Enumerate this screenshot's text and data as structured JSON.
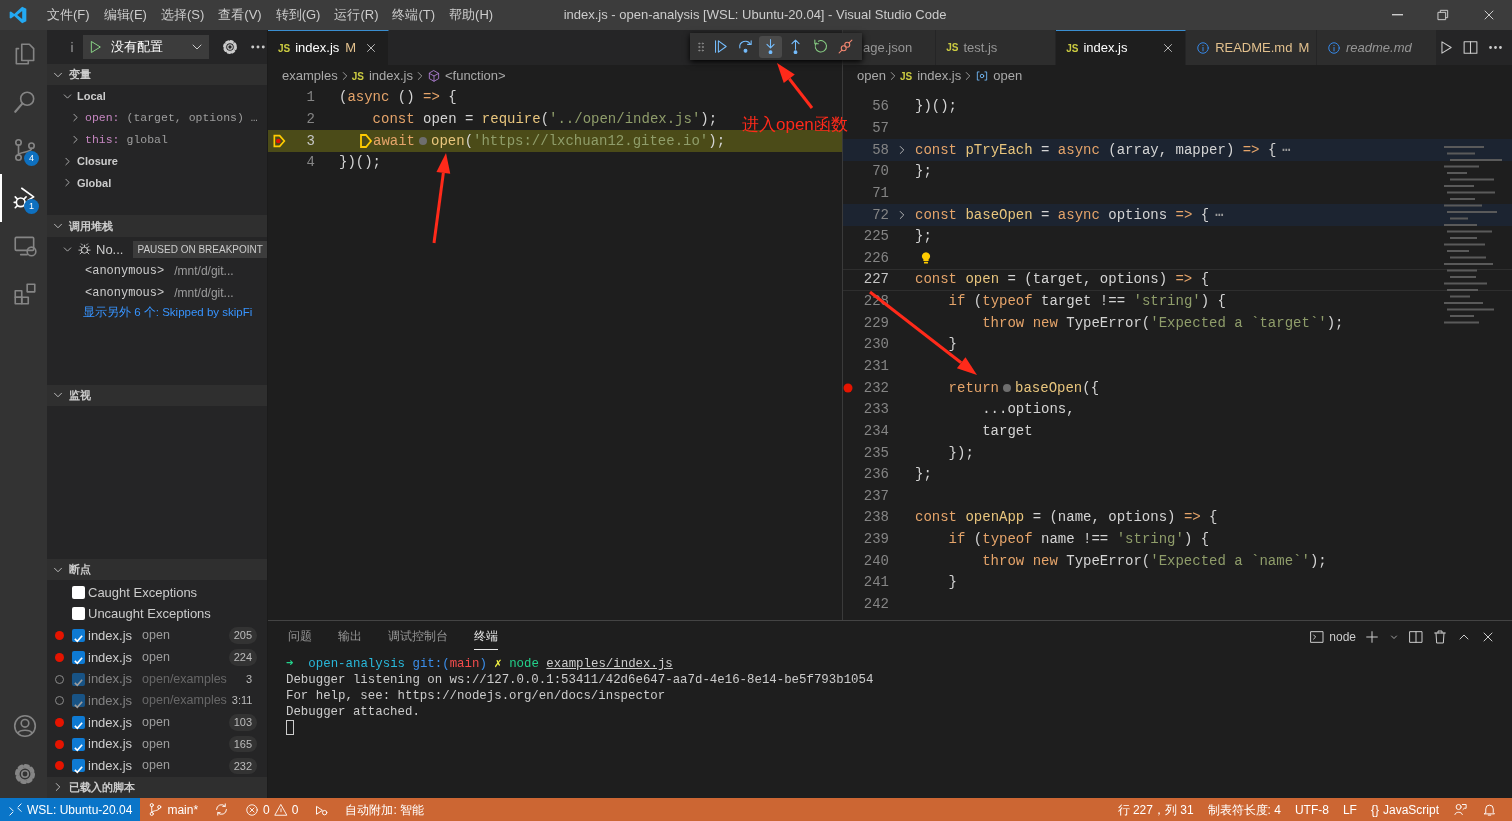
{
  "title_bar": {
    "menus": [
      "文件(F)",
      "编辑(E)",
      "选择(S)",
      "查看(V)",
      "转到(G)",
      "运行(R)",
      "终端(T)",
      "帮助(H)"
    ],
    "title": "index.js - open-analysis [WSL: Ubuntu-20.04] - Visual Studio Code"
  },
  "activity_bar": {
    "items": [
      {
        "kind": "files",
        "selected": false
      },
      {
        "kind": "search",
        "selected": false
      },
      {
        "kind": "scm",
        "selected": false,
        "badge": "4"
      },
      {
        "kind": "debug",
        "selected": true,
        "badge": "1"
      },
      {
        "kind": "remote",
        "selected": false
      },
      {
        "kind": "extensions",
        "selected": false
      }
    ],
    "bottom": [
      {
        "kind": "account"
      },
      {
        "kind": "settings"
      }
    ]
  },
  "sidebar": {
    "config": "没有配置",
    "variables": {
      "title": "变量",
      "expanded": true,
      "scopes": [
        {
          "label": "Local",
          "expanded": true,
          "children": [
            {
              "name": "open:",
              "value": "(target, options) …",
              "expanded": false
            },
            {
              "name": "this:",
              "value": "global",
              "expanded": false
            }
          ]
        },
        {
          "label": "Closure",
          "expanded": false
        },
        {
          "label": "Global",
          "expanded": false
        }
      ]
    },
    "call_stack": {
      "title": "调用堆栈",
      "expanded": true,
      "thread": "No...",
      "status": "PAUSED ON BREAKPOINT",
      "frames": [
        {
          "name": "<anonymous>",
          "path": "/mnt/d/git..."
        },
        {
          "name": "<anonymous>",
          "path": "/mnt/d/git..."
        }
      ],
      "more": "显示另外 6 个: Skipped by skipFi"
    },
    "watch": {
      "title": "监视",
      "expanded": true
    },
    "breakpoints": {
      "title": "断点",
      "expanded": true,
      "exceptions": [
        {
          "label": "Caught Exceptions",
          "checked": false
        },
        {
          "label": "Uncaught Exceptions",
          "checked": false
        }
      ],
      "items": [
        {
          "file": "index.js",
          "path": "open",
          "line": "205",
          "checked": true,
          "verified": true
        },
        {
          "file": "index.js",
          "path": "open",
          "line": "224",
          "checked": true,
          "verified": true
        },
        {
          "file": "index.js",
          "path": "open/examples",
          "line": "3",
          "checked": true,
          "verified": false
        },
        {
          "file": "index.js",
          "path": "open/examples",
          "line": "3:11",
          "checked": true,
          "verified": false
        },
        {
          "file": "index.js",
          "path": "open",
          "line": "103",
          "checked": true,
          "verified": true
        },
        {
          "file": "index.js",
          "path": "open",
          "line": "165",
          "checked": true,
          "verified": true
        },
        {
          "file": "index.js",
          "path": "open",
          "line": "232",
          "checked": true,
          "verified": true
        }
      ]
    },
    "loaded_scripts": {
      "title": "已载入的脚本",
      "expanded": false
    }
  },
  "debug_toolbar": {
    "buttons": [
      {
        "kind": "continue",
        "selected": false
      },
      {
        "kind": "step-over",
        "selected": false
      },
      {
        "kind": "step-into",
        "selected": true
      },
      {
        "kind": "step-out",
        "selected": false
      },
      {
        "kind": "restart",
        "selected": false
      },
      {
        "kind": "disconnect",
        "selected": false
      }
    ]
  },
  "left_editor": {
    "tabs": [
      {
        "label": "index.js",
        "kind": "js",
        "icon_text": "JS",
        "status": "M",
        "selected": true,
        "preview": false
      }
    ],
    "breadcrumbs": [
      {
        "label": "examples"
      },
      {
        "label": "index.js",
        "kind": "js",
        "icon_text": "JS"
      },
      {
        "label": "<function>",
        "kind": "function"
      }
    ],
    "lines": [
      {
        "number": "1",
        "breakpoint": false,
        "paused": false,
        "folded": false,
        "code": [
          {
            "kind": "plain",
            "text": "("
          },
          {
            "kind": "keyword",
            "text": "async"
          },
          {
            "kind": "plain",
            "text": " () "
          },
          {
            "kind": "keyword",
            "text": "=>"
          },
          {
            "kind": "plain",
            "text": " {"
          }
        ]
      },
      {
        "number": "2",
        "breakpoint": false,
        "paused": false,
        "folded": false,
        "code": [
          {
            "kind": "keyword",
            "text": "    const "
          },
          {
            "kind": "plain",
            "text": "open = "
          },
          {
            "kind": "function",
            "text": "require"
          },
          {
            "kind": "plain",
            "text": "("
          },
          {
            "kind": "string",
            "text": "'../open/index.js'"
          },
          {
            "kind": "plain",
            "text": ");"
          }
        ]
      },
      {
        "number": "3",
        "breakpoint": true,
        "paused": true,
        "folded": false,
        "code": [
          {
            "kind": "stop"
          },
          {
            "kind": "keyword",
            "text": "await"
          },
          {
            "kind": "dot"
          },
          {
            "kind": "function",
            "text": "open"
          },
          {
            "kind": "plain",
            "text": "("
          },
          {
            "kind": "string",
            "text": "'https://lxchuan12.gitee.io'"
          },
          {
            "kind": "plain",
            "text": ");"
          }
        ]
      },
      {
        "number": "4",
        "breakpoint": false,
        "paused": false,
        "folded": false,
        "code": [
          {
            "kind": "plain",
            "text": "})();"
          }
        ]
      }
    ]
  },
  "right_editor": {
    "tabs": [
      {
        "label": "age.json",
        "kind": "json",
        "selected": false,
        "preview": false
      },
      {
        "label": "test.js",
        "kind": "js",
        "icon_text": "JS",
        "selected": false,
        "preview": false
      },
      {
        "label": "index.js",
        "kind": "js",
        "icon_text": "JS",
        "selected": true,
        "preview": false
      },
      {
        "label": "README.md",
        "kind": "info",
        "status": "M",
        "selected": false,
        "preview": false
      },
      {
        "label": "readme.md",
        "kind": "info",
        "selected": false,
        "preview": true
      }
    ],
    "breadcrumbs": [
      {
        "label": "open"
      },
      {
        "label": "index.js",
        "kind": "js",
        "icon_text": "JS"
      },
      {
        "label": "open",
        "kind": "variable"
      }
    ],
    "lines": [
      {
        "number": "56",
        "breakpoint": false,
        "cursor": false,
        "folded": false,
        "code": [
          {
            "kind": "plain",
            "text": "})();"
          }
        ]
      },
      {
        "number": "57",
        "breakpoint": false,
        "cursor": false,
        "folded": false
      },
      {
        "number": "58",
        "breakpoint": false,
        "cursor": false,
        "folded": true,
        "code": [
          {
            "kind": "keyword",
            "text": "const "
          },
          {
            "kind": "function",
            "text": "pTryEach"
          },
          {
            "kind": "plain",
            "text": " = "
          },
          {
            "kind": "keyword",
            "text": "async "
          },
          {
            "kind": "plain",
            "text": "(array, mapper) "
          },
          {
            "kind": "keyword",
            "text": "=>"
          },
          {
            "kind": "plain",
            "text": " {"
          },
          {
            "kind": "fold",
            "text": "⋯"
          }
        ]
      },
      {
        "number": "70",
        "breakpoint": false,
        "cursor": false,
        "folded": false,
        "code": [
          {
            "kind": "plain",
            "text": "};"
          }
        ]
      },
      {
        "number": "71",
        "breakpoint": false,
        "cursor": false,
        "folded": false
      },
      {
        "number": "72",
        "breakpoint": false,
        "cursor": false,
        "folded": true,
        "code": [
          {
            "kind": "keyword",
            "text": "const "
          },
          {
            "kind": "function",
            "text": "baseOpen"
          },
          {
            "kind": "plain",
            "text": " = "
          },
          {
            "kind": "keyword",
            "text": "async "
          },
          {
            "kind": "plain",
            "text": "options "
          },
          {
            "kind": "keyword",
            "text": "=>"
          },
          {
            "kind": "plain",
            "text": " {"
          },
          {
            "kind": "fold",
            "text": "⋯"
          }
        ]
      },
      {
        "number": "225",
        "breakpoint": false,
        "cursor": false,
        "folded": false,
        "code": [
          {
            "kind": "plain",
            "text": "};"
          }
        ]
      },
      {
        "number": "226",
        "breakpoint": false,
        "cursor": false,
        "folded": false,
        "code": [
          {
            "kind": "bulb"
          }
        ]
      },
      {
        "number": "227",
        "breakpoint": false,
        "cursor": true,
        "folded": false,
        "code": [
          {
            "kind": "keyword",
            "text": "const "
          },
          {
            "kind": "function",
            "text": "open"
          },
          {
            "kind": "plain",
            "text": " = (target, options) "
          },
          {
            "kind": "keyword",
            "text": "=>"
          },
          {
            "kind": "plain",
            "text": " {"
          }
        ]
      },
      {
        "number": "228",
        "breakpoint": false,
        "cursor": false,
        "folded": false,
        "code": [
          {
            "kind": "keyword",
            "text": "    if "
          },
          {
            "kind": "plain",
            "text": "("
          },
          {
            "kind": "keyword",
            "text": "typeof"
          },
          {
            "kind": "plain",
            "text": " target !== "
          },
          {
            "kind": "string",
            "text": "'string'"
          },
          {
            "kind": "plain",
            "text": ") {"
          }
        ]
      },
      {
        "number": "229",
        "breakpoint": false,
        "cursor": false,
        "folded": false,
        "code": [
          {
            "kind": "keyword",
            "text": "        throw new "
          },
          {
            "kind": "plain",
            "text": "TypeError("
          },
          {
            "kind": "string",
            "text": "'Expected a `target`'"
          },
          {
            "kind": "plain",
            "text": ");"
          }
        ]
      },
      {
        "number": "230",
        "breakpoint": false,
        "cursor": false,
        "folded": false,
        "code": [
          {
            "kind": "plain",
            "text": "    }"
          }
        ]
      },
      {
        "number": "231",
        "breakpoint": false,
        "cursor": false,
        "folded": false
      },
      {
        "number": "232",
        "breakpoint": true,
        "cursor": false,
        "folded": false,
        "code": [
          {
            "kind": "keyword",
            "text": "    return"
          },
          {
            "kind": "dot"
          },
          {
            "kind": "function",
            "text": "baseOpen"
          },
          {
            "kind": "plain",
            "text": "({"
          }
        ]
      },
      {
        "number": "233",
        "breakpoint": false,
        "cursor": false,
        "folded": false,
        "code": [
          {
            "kind": "plain",
            "text": "        ...options,"
          }
        ]
      },
      {
        "number": "234",
        "breakpoint": false,
        "cursor": false,
        "folded": false,
        "code": [
          {
            "kind": "plain",
            "text": "        target"
          }
        ]
      },
      {
        "number": "235",
        "breakpoint": false,
        "cursor": false,
        "folded": false,
        "code": [
          {
            "kind": "plain",
            "text": "    });"
          }
        ]
      },
      {
        "number": "236",
        "breakpoint": false,
        "cursor": false,
        "folded": false,
        "code": [
          {
            "kind": "plain",
            "text": "};"
          }
        ]
      },
      {
        "number": "237",
        "breakpoint": false,
        "cursor": false,
        "folded": false
      },
      {
        "number": "238",
        "breakpoint": false,
        "cursor": false,
        "folded": false,
        "code": [
          {
            "kind": "keyword",
            "text": "const "
          },
          {
            "kind": "function",
            "text": "openApp"
          },
          {
            "kind": "plain",
            "text": " = (name, options) "
          },
          {
            "kind": "keyword",
            "text": "=>"
          },
          {
            "kind": "plain",
            "text": " {"
          }
        ]
      },
      {
        "number": "239",
        "breakpoint": false,
        "cursor": false,
        "folded": false,
        "code": [
          {
            "kind": "keyword",
            "text": "    if "
          },
          {
            "kind": "plain",
            "text": "("
          },
          {
            "kind": "keyword",
            "text": "typeof"
          },
          {
            "kind": "plain",
            "text": " name !== "
          },
          {
            "kind": "string",
            "text": "'string'"
          },
          {
            "kind": "plain",
            "text": ") {"
          }
        ]
      },
      {
        "number": "240",
        "breakpoint": false,
        "cursor": false,
        "folded": false,
        "code": [
          {
            "kind": "keyword",
            "text": "        throw new "
          },
          {
            "kind": "plain",
            "text": "TypeError("
          },
          {
            "kind": "string",
            "text": "'Expected a `name`'"
          },
          {
            "kind": "plain",
            "text": ");"
          }
        ]
      },
      {
        "number": "241",
        "breakpoint": false,
        "cursor": false,
        "folded": false,
        "code": [
          {
            "kind": "plain",
            "text": "    }"
          }
        ]
      },
      {
        "number": "242",
        "breakpoint": false,
        "cursor": false,
        "folded": false
      }
    ]
  },
  "annotation": {
    "text": "进入open函数"
  },
  "panel": {
    "tabs": [
      {
        "label": "问题",
        "selected": false
      },
      {
        "label": "输出",
        "selected": false
      },
      {
        "label": "调试控制台",
        "selected": false
      },
      {
        "label": "终端",
        "selected": true
      }
    ],
    "terminal_name": "node",
    "terminal": [
      {
        "segments": [
          {
            "kind": "prompt",
            "text": "➜  "
          },
          {
            "kind": "dir",
            "text": "open-analysis "
          },
          {
            "kind": "git",
            "text": "git:("
          },
          {
            "kind": "branch",
            "text": "main"
          },
          {
            "kind": "git",
            "text": ") "
          },
          {
            "kind": "dirty",
            "text": "✗ "
          },
          {
            "kind": "cmd",
            "text": "node "
          },
          {
            "kind": "arg",
            "text": "examples/index.js"
          }
        ]
      },
      {
        "segments": [
          {
            "kind": "out",
            "text": "Debugger listening on ws://127.0.0.1:53411/42d6e647-aa7d-4e16-8e14-be5f793b1054"
          }
        ]
      },
      {
        "segments": [
          {
            "kind": "out",
            "text": "For help, see: https://nodejs.org/en/docs/inspector"
          }
        ]
      },
      {
        "segments": [
          {
            "kind": "out",
            "text": "Debugger attached."
          }
        ]
      }
    ]
  },
  "status_bar": {
    "left": [
      {
        "kind": "remote",
        "text": "WSL: Ubuntu-20.04"
      },
      {
        "kind": "branch",
        "text": "main*"
      },
      {
        "kind": "sync"
      },
      {
        "kind": "problems",
        "errors": "0",
        "warnings": "0"
      },
      {
        "kind": "attach"
      },
      {
        "kind": "text",
        "text": "自动附加: 智能"
      }
    ],
    "right": [
      {
        "kind": "text",
        "text": "行 227，列 31"
      },
      {
        "kind": "text",
        "text": "制表符长度: 4"
      },
      {
        "kind": "text",
        "text": "UTF-8"
      },
      {
        "kind": "text",
        "text": "LF"
      },
      {
        "kind": "language",
        "icon_text": "{}",
        "text": "JavaScript"
      },
      {
        "kind": "feedback"
      },
      {
        "kind": "bell"
      }
    ]
  }
}
